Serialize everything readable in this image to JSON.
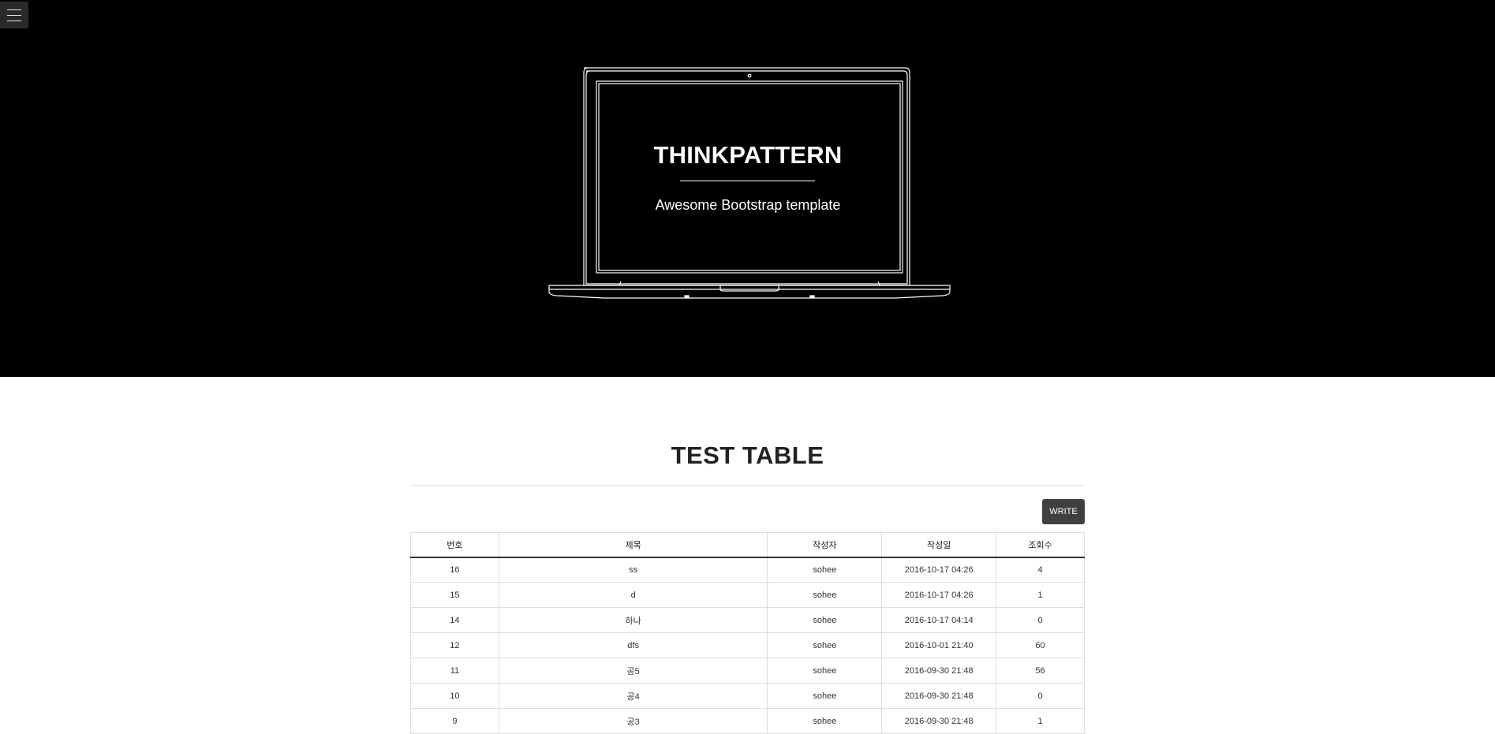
{
  "hero": {
    "title": "THINKPATTERN",
    "subtitle": "Awesome Bootstrap template"
  },
  "page": {
    "title": "TEST TABLE",
    "write_label": "WRITE"
  },
  "table": {
    "headers": [
      "번호",
      "제목",
      "작성자",
      "작성일",
      "조회수"
    ],
    "rows": [
      [
        "16",
        "ss",
        "sohee",
        "2016-10-17 04:26",
        "4"
      ],
      [
        "15",
        "d",
        "sohee",
        "2016-10-17 04:26",
        "1"
      ],
      [
        "14",
        "하나",
        "sohee",
        "2016-10-17 04:14",
        "0"
      ],
      [
        "12",
        "dfs",
        "sohee",
        "2016-10-01 21:40",
        "60"
      ],
      [
        "11",
        "공5",
        "sohee",
        "2016-09-30 21:48",
        "56"
      ],
      [
        "10",
        "공4",
        "sohee",
        "2016-09-30 21:48",
        "0"
      ],
      [
        "9",
        "공3",
        "sohee",
        "2016-09-30 21:48",
        "1"
      ]
    ]
  },
  "icons": {
    "menu": "hamburger-menu-icon",
    "laptop": "laptop-outline-icon"
  },
  "colors": {
    "hero_bg": "#000000",
    "write_button": "#404040"
  }
}
